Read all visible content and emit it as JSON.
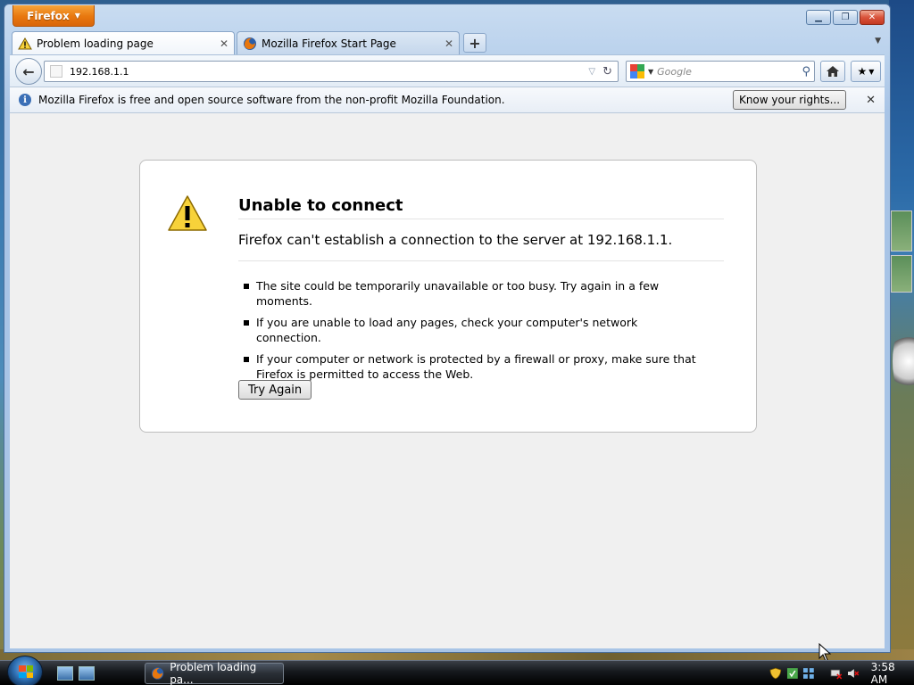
{
  "app": {
    "menu_button": "Firefox"
  },
  "tabs": [
    {
      "title": "Problem loading page",
      "active": true
    },
    {
      "title": "Mozilla Firefox Start Page",
      "active": false
    }
  ],
  "navbar": {
    "url": "192.168.1.1",
    "search_placeholder": "Google"
  },
  "notification": {
    "message": "Mozilla Firefox is free and open source software from the non-profit Mozilla Foundation.",
    "button_label": "Know your rights..."
  },
  "error": {
    "title": "Unable to connect",
    "short_desc": "Firefox can't establish a connection to the server at 192.168.1.1.",
    "items": [
      "The site could be temporarily unavailable or too busy. Try again in a few moments.",
      "If you are unable to load any pages, check your computer's network connection.",
      "If your computer or network is protected by a firewall or proxy, make sure that Firefox is permitted to access the Web."
    ],
    "try_again_label": "Try Again"
  },
  "taskbar": {
    "task_label": "Problem loading pa...",
    "clock": "3:58 AM"
  },
  "colors": {
    "firefox_orange": "#e8770e",
    "close_red": "#c43a22",
    "info_blue": "#3b6fb6"
  }
}
